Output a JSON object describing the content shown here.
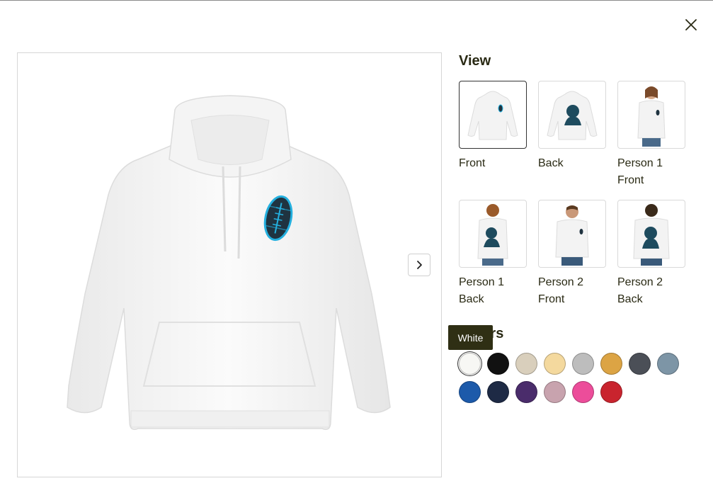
{
  "close_icon": "close-icon",
  "next_icon": "chevron-right-icon",
  "view": {
    "title": "View",
    "thumbnails": [
      {
        "line1": "Front",
        "line2": "",
        "selected": true
      },
      {
        "line1": "Back",
        "line2": ""
      },
      {
        "line1": "Person 1",
        "line2": "Front"
      },
      {
        "line1": "Person 1",
        "line2": "Back"
      },
      {
        "line1": "Person 2",
        "line2": "Front"
      },
      {
        "line1": "Person 2",
        "line2": "Back"
      }
    ]
  },
  "colors": {
    "title": "Colors",
    "tooltip": "White",
    "swatches": [
      {
        "color": "#f7f7f4",
        "selected": true
      },
      {
        "color": "#111111"
      },
      {
        "color": "#d9cfbc"
      },
      {
        "color": "#f4d99e"
      },
      {
        "color": "#bdbdbd"
      },
      {
        "color": "#dca444"
      },
      {
        "color": "#4b4f57"
      },
      {
        "color": "#7d95a6"
      },
      {
        "color": "#1c5aaa"
      },
      {
        "color": "#1e2a45"
      },
      {
        "color": "#4a2c6b"
      },
      {
        "color": "#c8a3ae"
      },
      {
        "color": "#ec4d9a"
      },
      {
        "color": "#c9242e"
      }
    ]
  }
}
